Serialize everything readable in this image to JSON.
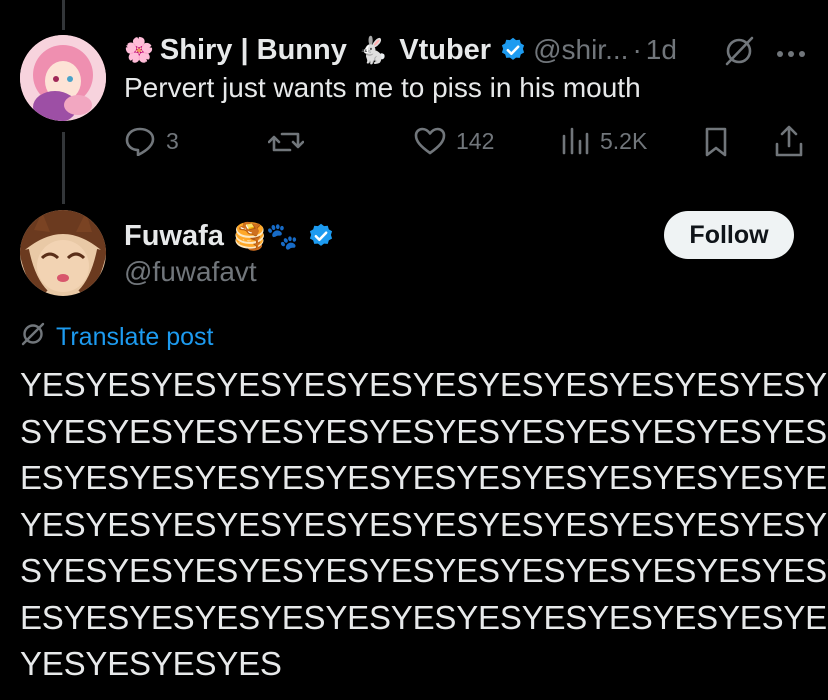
{
  "reply_tweet": {
    "display_name": "Shiry | Bunny",
    "display_name_emoji_prefix": "🌸",
    "display_name_emoji_mid": "🐇",
    "display_name_suffix": "Vtuber",
    "handle": "@shir...",
    "separator": "·",
    "time": "1d",
    "text": "Pervert just wants me to piss in his mouth",
    "actions": {
      "replies": "3",
      "likes": "142",
      "views": "5.2K"
    }
  },
  "main_tweet": {
    "display_name": "Fuwafa",
    "name_emojis": "🥞🐾",
    "handle": "@fuwafavt",
    "follow_label": "Follow",
    "translate_label": "Translate post",
    "body_lines": [
      "YESYESYESYESYESYESYESYESYESYESYESYESYE",
      "SYESYESYESYESYESYESYESYESYESYESYESYESY",
      "ESYESYESYESYESYESYESYESYESYESYESYESYES",
      "YESYESYESYESYESYESYESYESYESYESYESYESYE",
      "SYESYESYESYESYESYESYESYESYESYESYESYESY",
      "ESYESYESYESYESYESYESYESYESYESYESYESYES",
      "YESYESYESYES"
    ]
  },
  "colors": {
    "background": "#000000",
    "text": "#e7e9ea",
    "muted": "#71767b",
    "accent": "#1d9bf0",
    "follow_bg": "#eff3f4"
  },
  "icons": [
    "verified-badge-icon",
    "grok-icon",
    "more-icon",
    "reply-icon",
    "repost-icon",
    "like-icon",
    "views-icon",
    "bookmark-icon",
    "share-icon",
    "translate-icon"
  ]
}
